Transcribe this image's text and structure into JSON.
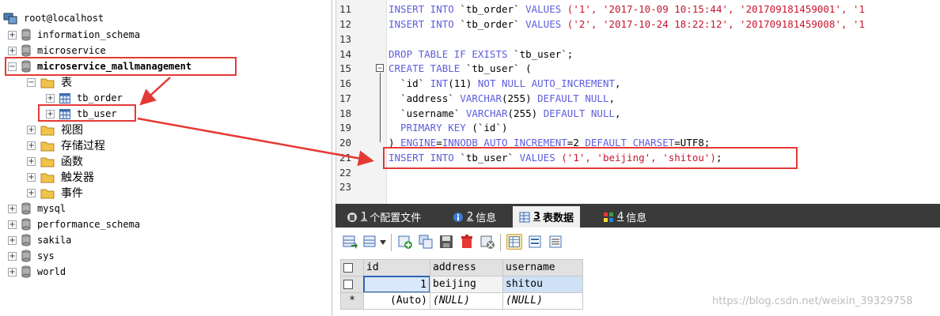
{
  "tree": {
    "root": "root@localhost",
    "databases": [
      {
        "name": "information_schema"
      },
      {
        "name": "microservice"
      },
      {
        "name": "microservice_mallmanagement"
      }
    ],
    "tables_folder": "表",
    "tables": [
      "tb_order",
      "tb_user"
    ],
    "folders": [
      "视图",
      "存储过程",
      "函数",
      "触发器",
      "事件"
    ],
    "other_databases": [
      "mysql",
      "performance_schema",
      "sakila",
      "sys",
      "world"
    ]
  },
  "editor": {
    "line_numbers": [
      "11",
      "12",
      "13",
      "14",
      "15",
      "16",
      "17",
      "18",
      "19",
      "20",
      "21",
      "22",
      "23"
    ],
    "lines": [
      "INSERT INTO `tb_order` VALUES ('1', '2017-10-09 10:15:44', '201709181459001', '1",
      "INSERT INTO `tb_order` VALUES ('2', '2017-10-24 18:22:12', '201709181459008', '1",
      "",
      "DROP TABLE IF EXISTS `tb_user`;",
      "CREATE TABLE `tb_user` (",
      "  `id` INT(11) NOT NULL AUTO_INCREMENT,",
      "  `address` VARCHAR(255) DEFAULT NULL,",
      "  `username` VARCHAR(255) DEFAULT NULL,",
      "  PRIMARY KEY (`id`)",
      ") ENGINE=INNODB AUTO_INCREMENT=2 DEFAULT CHARSET=UTF8;",
      "INSERT INTO `tb_user` VALUES ('1', 'beijing', 'shitou');",
      "",
      ""
    ]
  },
  "tabs": [
    {
      "num": "1",
      "label": "个配置文件"
    },
    {
      "num": "2",
      "label": "信息"
    },
    {
      "num": "3",
      "label": "表数据"
    },
    {
      "num": "4",
      "label": "信息"
    }
  ],
  "grid": {
    "columns": [
      "id",
      "address",
      "username"
    ],
    "rows": [
      {
        "id": "1",
        "address": "beijing",
        "username": "shitou"
      }
    ],
    "new_row": {
      "marker": "*",
      "id": "(Auto)",
      "address": "(NULL)",
      "username": "(NULL)"
    }
  },
  "watermark": "https://blog.csdn.net/weixin_39329758",
  "colors": {
    "keyword": "#5d5dde",
    "string": "#c6162d",
    "annotation": "#e53935"
  }
}
